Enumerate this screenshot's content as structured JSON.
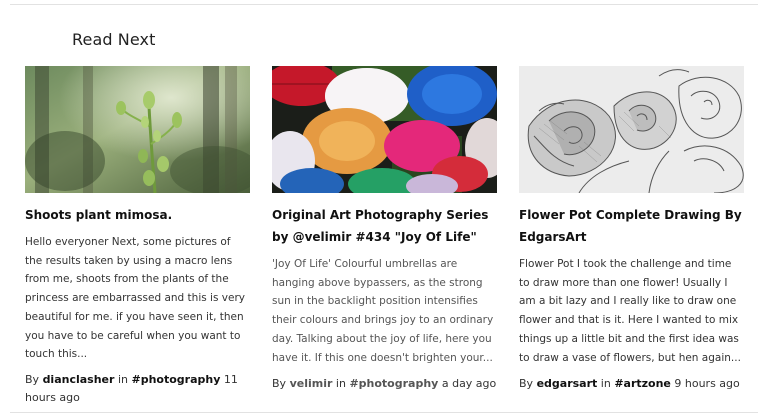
{
  "section": {
    "title": "Read Next"
  },
  "cards": [
    {
      "title": "Shoots plant mimosa.",
      "excerpt": "Hello everyoner Next, some pictures of the results taken by using a macro lens from me, shoots from the plants of the princess are embarrassed and this is very beautiful for me. if you have seen it, then you have to be careful when you want to touch this...",
      "by": "By",
      "author": "dianclasher",
      "in": "in",
      "tag": "#photography",
      "time": "11 hours ago",
      "thumb_icon": "plant-shoot-photo"
    },
    {
      "title": "Original Art Photography Series by @velimir #434 \"Joy Of Life\"",
      "excerpt": "'Joy Of Life' Colourful umbrellas are hanging above bypassers, as the strong sun in the backlight position intensifies their colours and brings joy to an ordinary day. Talking about the joy of life, here you have it. If this one doesn't brighten your...",
      "by": "By",
      "author": "velimir",
      "in": "in",
      "tag": "#photography",
      "time": "a day ago",
      "thumb_icon": "umbrellas-photo"
    },
    {
      "title": "Flower Pot Complete Drawing By EdgarsArt",
      "excerpt": "Flower Pot I took the challenge and time to draw more than one flower! Usually I am a bit lazy and I really like to draw one flower and that is it. Here I wanted to mix things up a little bit and the first idea was to draw a vase of flowers, but hen again...",
      "by": "By",
      "author": "edgarsart",
      "in": "in",
      "tag": "#artzone",
      "time": "9 hours ago",
      "thumb_icon": "flower-drawing-image"
    }
  ]
}
